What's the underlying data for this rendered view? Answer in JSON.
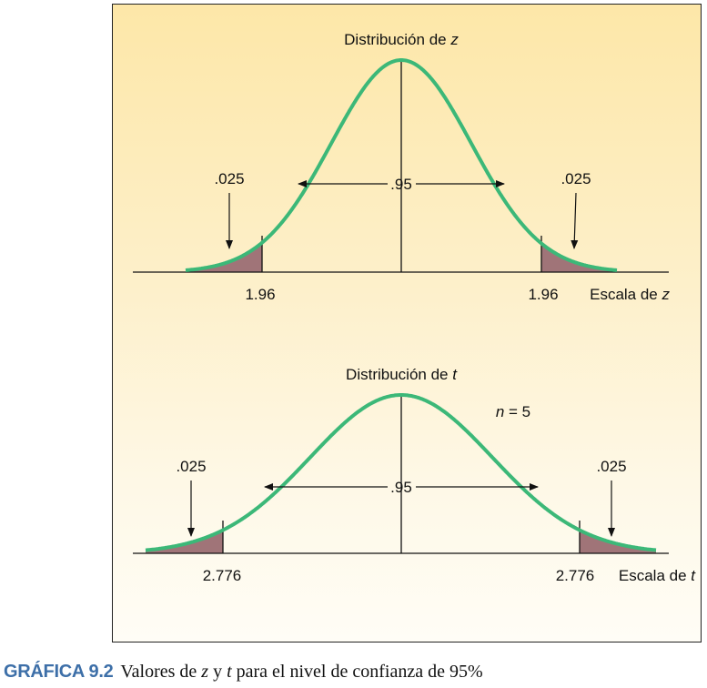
{
  "caption": {
    "label": "GRÁFICA 9.2",
    "text_part1": "Valores de ",
    "var_z": "z",
    "text_part2": " y ",
    "var_t": "t",
    "text_part3": " para el nivel de confianza de 95%"
  },
  "z_panel": {
    "title_prefix": "Distribución de ",
    "title_var": "z",
    "center_area": ".95",
    "left_tail": ".025",
    "right_tail": ".025",
    "left_value": "1.96",
    "right_value": "1.96",
    "scale_prefix": "Escala de ",
    "scale_var": "z"
  },
  "t_panel": {
    "title_prefix": "Distribución de ",
    "title_var": "t",
    "df_var": "n",
    "df_text": " = 5",
    "center_area": ".95",
    "left_tail": ".025",
    "right_tail": ".025",
    "left_value": "2.776",
    "right_value": "2.776",
    "scale_prefix": "Escala de ",
    "scale_var": "t"
  },
  "colors": {
    "curve": "#3cb878",
    "tail_fill": "#a07478",
    "axis": "#111111",
    "caption_label": "#3d6fa8"
  }
}
